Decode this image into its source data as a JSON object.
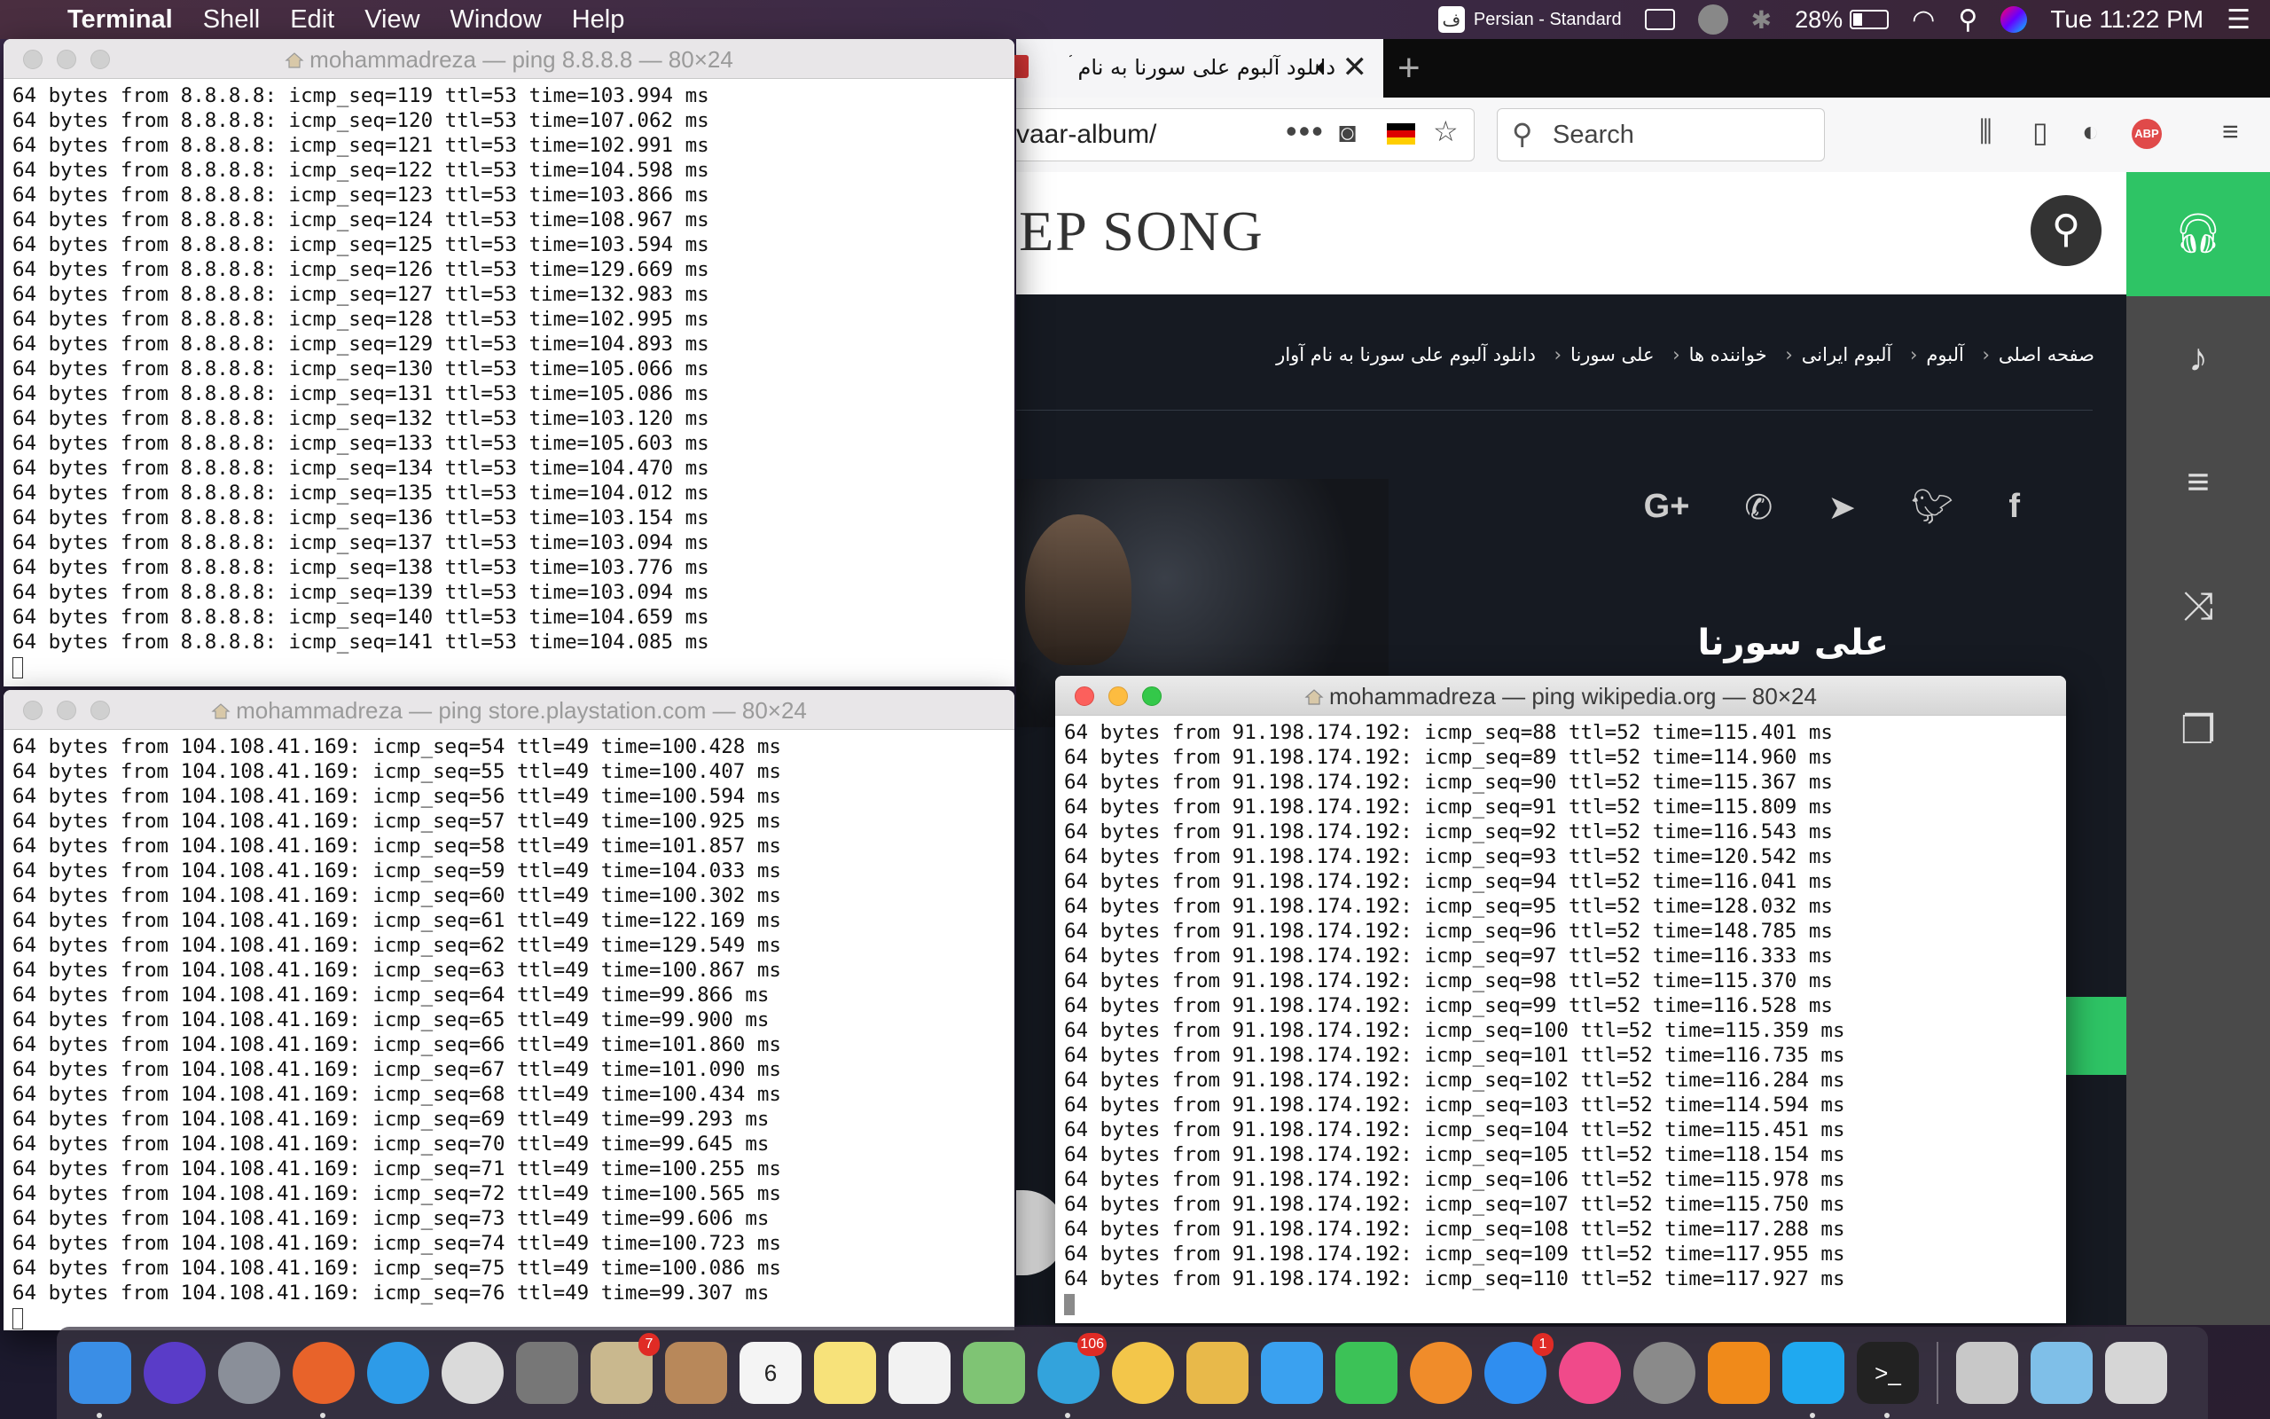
{
  "menubar": {
    "app_name": "Terminal",
    "menus": [
      "Shell",
      "Edit",
      "View",
      "Window",
      "Help"
    ],
    "input_source": "Persian - Standard",
    "battery": "28%",
    "clock": "Tue 11:22 PM"
  },
  "browser": {
    "tab_title": "دانلود آلبوم علی سورنا به نام آوار",
    "url": "vaar-album/",
    "search_placeholder": "Search",
    "site_logo": "EEP SONG",
    "breadcrumbs": [
      "صفحه اصلی",
      "آلبوم",
      "آلبوم ایرانی",
      "خواننده ها",
      "علی سورنا",
      "دانلود آلبوم علی سورنا به نام آوار"
    ],
    "breadcrumb_sep": "‹",
    "artist_name": "علی سورنا"
  },
  "terminals": {
    "google": {
      "title": "mohammadreza — ping 8.8.8.8 — 80×24",
      "lines": [
        "64 bytes from 8.8.8.8: icmp_seq=119 ttl=53 time=103.994 ms",
        "64 bytes from 8.8.8.8: icmp_seq=120 ttl=53 time=107.062 ms",
        "64 bytes from 8.8.8.8: icmp_seq=121 ttl=53 time=102.991 ms",
        "64 bytes from 8.8.8.8: icmp_seq=122 ttl=53 time=104.598 ms",
        "64 bytes from 8.8.8.8: icmp_seq=123 ttl=53 time=103.866 ms",
        "64 bytes from 8.8.8.8: icmp_seq=124 ttl=53 time=108.967 ms",
        "64 bytes from 8.8.8.8: icmp_seq=125 ttl=53 time=103.594 ms",
        "64 bytes from 8.8.8.8: icmp_seq=126 ttl=53 time=129.669 ms",
        "64 bytes from 8.8.8.8: icmp_seq=127 ttl=53 time=132.983 ms",
        "64 bytes from 8.8.8.8: icmp_seq=128 ttl=53 time=102.995 ms",
        "64 bytes from 8.8.8.8: icmp_seq=129 ttl=53 time=104.893 ms",
        "64 bytes from 8.8.8.8: icmp_seq=130 ttl=53 time=105.066 ms",
        "64 bytes from 8.8.8.8: icmp_seq=131 ttl=53 time=105.086 ms",
        "64 bytes from 8.8.8.8: icmp_seq=132 ttl=53 time=103.120 ms",
        "64 bytes from 8.8.8.8: icmp_seq=133 ttl=53 time=105.603 ms",
        "64 bytes from 8.8.8.8: icmp_seq=134 ttl=53 time=104.470 ms",
        "64 bytes from 8.8.8.8: icmp_seq=135 ttl=53 time=104.012 ms",
        "64 bytes from 8.8.8.8: icmp_seq=136 ttl=53 time=103.154 ms",
        "64 bytes from 8.8.8.8: icmp_seq=137 ttl=53 time=103.094 ms",
        "64 bytes from 8.8.8.8: icmp_seq=138 ttl=53 time=103.776 ms",
        "64 bytes from 8.8.8.8: icmp_seq=139 ttl=53 time=103.094 ms",
        "64 bytes from 8.8.8.8: icmp_seq=140 ttl=53 time=104.659 ms",
        "64 bytes from 8.8.8.8: icmp_seq=141 ttl=53 time=104.085 ms"
      ]
    },
    "playstation": {
      "title": "mohammadreza — ping store.playstation.com — 80×24",
      "lines": [
        "64 bytes from 104.108.41.169: icmp_seq=54 ttl=49 time=100.428 ms",
        "64 bytes from 104.108.41.169: icmp_seq=55 ttl=49 time=100.407 ms",
        "64 bytes from 104.108.41.169: icmp_seq=56 ttl=49 time=100.594 ms",
        "64 bytes from 104.108.41.169: icmp_seq=57 ttl=49 time=100.925 ms",
        "64 bytes from 104.108.41.169: icmp_seq=58 ttl=49 time=101.857 ms",
        "64 bytes from 104.108.41.169: icmp_seq=59 ttl=49 time=104.033 ms",
        "64 bytes from 104.108.41.169: icmp_seq=60 ttl=49 time=100.302 ms",
        "64 bytes from 104.108.41.169: icmp_seq=61 ttl=49 time=122.169 ms",
        "64 bytes from 104.108.41.169: icmp_seq=62 ttl=49 time=129.549 ms",
        "64 bytes from 104.108.41.169: icmp_seq=63 ttl=49 time=100.867 ms",
        "64 bytes from 104.108.41.169: icmp_seq=64 ttl=49 time=99.866 ms",
        "64 bytes from 104.108.41.169: icmp_seq=65 ttl=49 time=99.900 ms",
        "64 bytes from 104.108.41.169: icmp_seq=66 ttl=49 time=101.860 ms",
        "64 bytes from 104.108.41.169: icmp_seq=67 ttl=49 time=101.090 ms",
        "64 bytes from 104.108.41.169: icmp_seq=68 ttl=49 time=100.434 ms",
        "64 bytes from 104.108.41.169: icmp_seq=69 ttl=49 time=99.293 ms",
        "64 bytes from 104.108.41.169: icmp_seq=70 ttl=49 time=99.645 ms",
        "64 bytes from 104.108.41.169: icmp_seq=71 ttl=49 time=100.255 ms",
        "64 bytes from 104.108.41.169: icmp_seq=72 ttl=49 time=100.565 ms",
        "64 bytes from 104.108.41.169: icmp_seq=73 ttl=49 time=99.606 ms",
        "64 bytes from 104.108.41.169: icmp_seq=74 ttl=49 time=100.723 ms",
        "64 bytes from 104.108.41.169: icmp_seq=75 ttl=49 time=100.086 ms",
        "64 bytes from 104.108.41.169: icmp_seq=76 ttl=49 time=99.307 ms"
      ]
    },
    "wikipedia": {
      "title": "mohammadreza — ping wikipedia.org — 80×24",
      "lines": [
        "64 bytes from 91.198.174.192: icmp_seq=88 ttl=52 time=115.401 ms",
        "64 bytes from 91.198.174.192: icmp_seq=89 ttl=52 time=114.960 ms",
        "64 bytes from 91.198.174.192: icmp_seq=90 ttl=52 time=115.367 ms",
        "64 bytes from 91.198.174.192: icmp_seq=91 ttl=52 time=115.809 ms",
        "64 bytes from 91.198.174.192: icmp_seq=92 ttl=52 time=116.543 ms",
        "64 bytes from 91.198.174.192: icmp_seq=93 ttl=52 time=120.542 ms",
        "64 bytes from 91.198.174.192: icmp_seq=94 ttl=52 time=116.041 ms",
        "64 bytes from 91.198.174.192: icmp_seq=95 ttl=52 time=128.032 ms",
        "64 bytes from 91.198.174.192: icmp_seq=96 ttl=52 time=148.785 ms",
        "64 bytes from 91.198.174.192: icmp_seq=97 ttl=52 time=116.333 ms",
        "64 bytes from 91.198.174.192: icmp_seq=98 ttl=52 time=115.370 ms",
        "64 bytes from 91.198.174.192: icmp_seq=99 ttl=52 time=116.528 ms",
        "64 bytes from 91.198.174.192: icmp_seq=100 ttl=52 time=115.359 ms",
        "64 bytes from 91.198.174.192: icmp_seq=101 ttl=52 time=116.735 ms",
        "64 bytes from 91.198.174.192: icmp_seq=102 ttl=52 time=116.284 ms",
        "64 bytes from 91.198.174.192: icmp_seq=103 ttl=52 time=114.594 ms",
        "64 bytes from 91.198.174.192: icmp_seq=104 ttl=52 time=115.451 ms",
        "64 bytes from 91.198.174.192: icmp_seq=105 ttl=52 time=118.154 ms",
        "64 bytes from 91.198.174.192: icmp_seq=106 ttl=52 time=115.978 ms",
        "64 bytes from 91.198.174.192: icmp_seq=107 ttl=52 time=115.750 ms",
        "64 bytes from 91.198.174.192: icmp_seq=108 ttl=52 time=117.288 ms",
        "64 bytes from 91.198.174.192: icmp_seq=109 ttl=52 time=117.955 ms",
        "64 bytes from 91.198.174.192: icmp_seq=110 ttl=52 time=117.927 ms"
      ]
    }
  },
  "dock": {
    "apps": [
      {
        "icon": "finder-icon",
        "color": "#3a8ee6",
        "running": true,
        "badge": ""
      },
      {
        "icon": "siri-icon",
        "color": "#5a3cc8",
        "running": false,
        "badge": ""
      },
      {
        "icon": "launchpad-icon",
        "color": "#8a8f99",
        "running": false,
        "badge": ""
      },
      {
        "icon": "firefox-icon",
        "color": "#e8632a",
        "running": true,
        "badge": ""
      },
      {
        "icon": "safari-icon",
        "color": "#2d9be8",
        "running": false,
        "badge": ""
      },
      {
        "icon": "chrome-icon",
        "color": "#dadada",
        "running": false,
        "badge": ""
      },
      {
        "icon": "migration-assistant-icon",
        "color": "#777777",
        "running": false,
        "badge": ""
      },
      {
        "icon": "mail-icon",
        "color": "#c9b88e",
        "running": false,
        "badge": "7"
      },
      {
        "icon": "contacts-icon",
        "color": "#b8885a",
        "running": false,
        "badge": ""
      },
      {
        "icon": "calendar-icon",
        "color": "#f4f4f4",
        "running": false,
        "badge": "",
        "label": "6"
      },
      {
        "icon": "notes-icon",
        "color": "#f7e27a",
        "running": false,
        "badge": ""
      },
      {
        "icon": "reminders-icon",
        "color": "#f2f2f2",
        "running": false,
        "badge": ""
      },
      {
        "icon": "maps-icon",
        "color": "#7fc474",
        "running": false,
        "badge": ""
      },
      {
        "icon": "telegram-icon",
        "color": "#33a3dc",
        "running": true,
        "badge": "106"
      },
      {
        "icon": "photos-icon",
        "color": "#f3c64a",
        "running": false,
        "badge": ""
      },
      {
        "icon": "archive-folder-icon",
        "color": "#e8b94a",
        "running": false,
        "badge": ""
      },
      {
        "icon": "messages-icon",
        "color": "#3aa1f0",
        "running": false,
        "badge": ""
      },
      {
        "icon": "facetime-icon",
        "color": "#3cc257",
        "running": false,
        "badge": ""
      },
      {
        "icon": "books-icon",
        "color": "#f08c2a",
        "running": false,
        "badge": ""
      },
      {
        "icon": "app-store-icon",
        "color": "#2f8ef0",
        "running": false,
        "badge": "1"
      },
      {
        "icon": "itunes-icon",
        "color": "#f04a8a",
        "running": false,
        "badge": ""
      },
      {
        "icon": "system-preferences-icon",
        "color": "#8a8a8a",
        "running": false,
        "badge": ""
      },
      {
        "icon": "vlc-icon",
        "color": "#f08a1a",
        "running": false,
        "badge": ""
      },
      {
        "icon": "skype-icon",
        "color": "#1fa9f0",
        "running": true,
        "badge": ""
      },
      {
        "icon": "terminal-icon",
        "color": "#222222",
        "running": true,
        "badge": "",
        "label": ">_"
      }
    ],
    "docs": [
      {
        "icon": "document-stack-icon",
        "color": "#c8c8c8"
      },
      {
        "icon": "preview-image-icon",
        "color": "#7fbfe8"
      },
      {
        "icon": "trash-icon",
        "color": "#d6d6d6"
      }
    ]
  }
}
